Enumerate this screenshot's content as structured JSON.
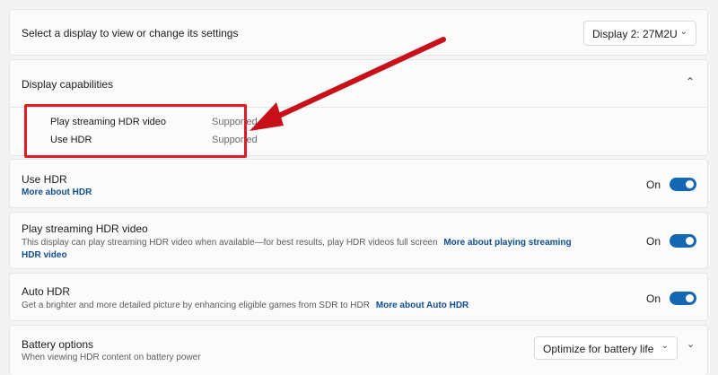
{
  "display_select": {
    "label": "Select a display to view or change its settings",
    "value": "Display 2: 27M2U"
  },
  "capabilities": {
    "title": "Display capabilities",
    "items": [
      {
        "name": "Play streaming HDR video",
        "status": "Supported"
      },
      {
        "name": "Use HDR",
        "status": "Supported"
      }
    ]
  },
  "use_hdr": {
    "title": "Use HDR",
    "link": "More about HDR",
    "state": "On"
  },
  "streaming_hdr": {
    "title": "Play streaming HDR video",
    "desc": "This display can play streaming HDR video when available—for best results, play HDR videos full screen",
    "link_line1": "More about playing streaming",
    "link_line2": "HDR video",
    "state": "On"
  },
  "auto_hdr": {
    "title": "Auto HDR",
    "desc": "Get a brighter and more detailed picture by enhancing eligible games from SDR to HDR",
    "link": "More about Auto HDR",
    "state": "On"
  },
  "battery": {
    "title": "Battery options",
    "desc": "When viewing HDR content on battery power",
    "value": "Optimize for battery life"
  },
  "colors": {
    "accent": "#1567b4",
    "link": "#0f4f8f",
    "annotation": "#e01b24"
  }
}
